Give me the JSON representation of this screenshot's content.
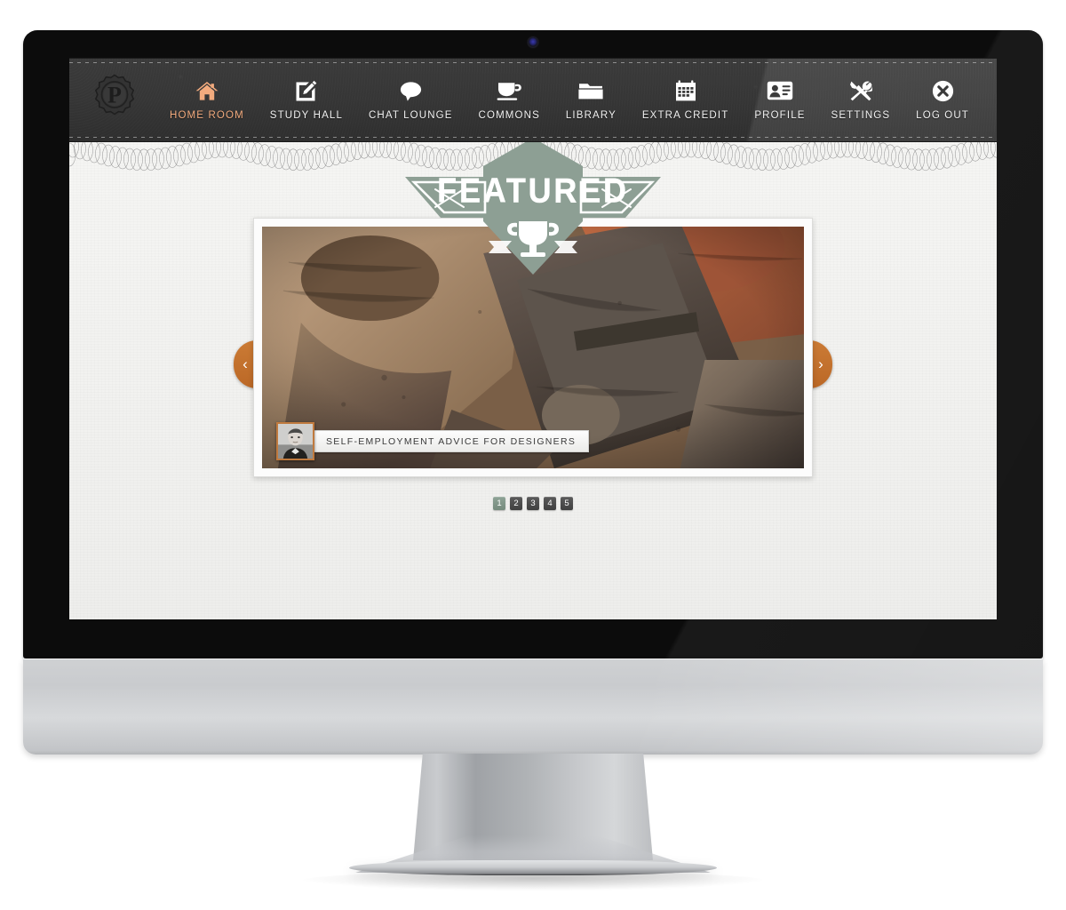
{
  "site": {
    "logo_letter": "P",
    "logo_name": "seal-logo"
  },
  "nav": {
    "items": [
      {
        "label": "HOME ROOM",
        "icon": "home-icon",
        "active": true
      },
      {
        "label": "STUDY HALL",
        "icon": "pencil-note-icon",
        "active": false
      },
      {
        "label": "CHAT LOUNGE",
        "icon": "speech-bubble-icon",
        "active": false
      },
      {
        "label": "COMMONS",
        "icon": "coffee-cup-icon",
        "active": false
      },
      {
        "label": "LIBRARY",
        "icon": "folder-icon",
        "active": false
      },
      {
        "label": "EXTRA CREDIT",
        "icon": "calendar-icon",
        "active": false
      },
      {
        "label": "PROFILE",
        "icon": "id-card-icon",
        "active": false
      },
      {
        "label": "SETTINGS",
        "icon": "tools-icon",
        "active": false
      },
      {
        "label": "LOG OUT",
        "icon": "close-circle-icon",
        "active": false
      }
    ]
  },
  "featured": {
    "badge_text": "FEATURED",
    "badge_color": "#8d9f94",
    "slide_title": "SELF-EMPLOYMENT ADVICE FOR DESIGNERS",
    "author_avatar": "author-portrait",
    "photo_alt": "letterpress-wood-type-blocks",
    "prev_label": "‹",
    "next_label": "›",
    "pages": [
      {
        "number": "1",
        "active": true
      },
      {
        "number": "2",
        "active": false
      },
      {
        "number": "3",
        "active": false
      },
      {
        "number": "4",
        "active": false
      },
      {
        "number": "5",
        "active": false
      }
    ]
  },
  "theme": {
    "accent_orange": "#f3ab7e",
    "arrow_orange": "#c4702c",
    "sage_green": "#8d9f94",
    "nav_dark": "#373737"
  }
}
